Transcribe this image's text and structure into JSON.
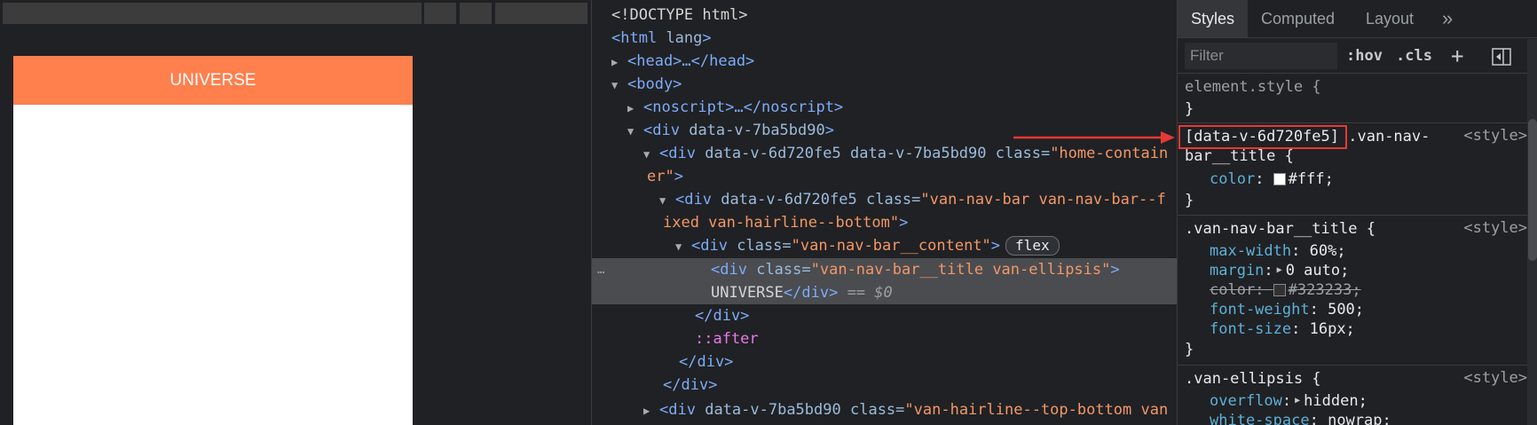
{
  "preview": {
    "app_title": "UNIVERSE",
    "navbar_color": "#ff7f4d"
  },
  "elements": {
    "lines": [
      {
        "doctype": "<!DOCTYPE html>"
      },
      {
        "html_open": "<html",
        "attr": "lang",
        "close": ">"
      },
      {
        "head": "<head>…</head>"
      },
      {
        "body": "<body>"
      },
      {
        "noscript": "<noscript>…</noscript>"
      },
      {
        "tag": "<div",
        "attr": "data-v-7ba5bd90",
        "close": ">"
      },
      {
        "tag": "<div",
        "attr1": "data-v-6d720fe5",
        "attr2": "data-v-7ba5bd90",
        "attr3": "class=",
        "val": "\"home-contain",
        "val_cont": "er\"",
        "close": ">"
      },
      {
        "tag": "<div",
        "attr1": "data-v-6d720fe5",
        "attr2": "class=",
        "val": "\"van-nav-bar van-nav-bar--f",
        "val_cont": "ixed van-hairline--bottom\"",
        "close": ">"
      },
      {
        "tag": "<div",
        "attr": "class=",
        "val": "\"van-nav-bar__content\"",
        "close": ">",
        "badge": "flex"
      },
      {
        "tag": "<div",
        "attr": "class=",
        "val": "\"van-nav-bar__title van-ellipsis\"",
        "close": ">",
        "text": "UNIVERSE",
        "end_tag": "</div>",
        "eq": "== ",
        "eq_var": "$0",
        "dots": "…"
      },
      {
        "close_div1": "</div>"
      },
      {
        "after": "::after"
      },
      {
        "close_div2": "</div>"
      },
      {
        "close_div3": "</div>"
      },
      {
        "tag": "<div",
        "attr1": "data-v-7ba5bd90",
        "attr2": "class=",
        "val": "\"van-hairline--top-bottom van"
      }
    ]
  },
  "styles": {
    "tabs": [
      "Styles",
      "Computed",
      "Layout"
    ],
    "more_tabs": "»",
    "filter_placeholder": "Filter",
    "hov": ":hov",
    "cls": ".cls",
    "plus": "+",
    "element_style": "element.style {",
    "close_brace": "}",
    "rule1": {
      "selector_attr": "[data-v-6d720fe5]",
      "selector_rest": ".van-nav-",
      "selector_cont": "bar__title {",
      "source": "<style>",
      "prop": "color",
      "val": "#fff;"
    },
    "rule2": {
      "selector": ".van-nav-bar__title {",
      "source": "<style>",
      "props": [
        {
          "name": "max-width",
          "value": "60%;"
        },
        {
          "name": "margin",
          "value": "0 auto;"
        },
        {
          "name": "color",
          "value": "#323233;"
        },
        {
          "name": "font-weight",
          "value": "500;"
        },
        {
          "name": "font-size",
          "value": "16px;"
        }
      ]
    },
    "rule3": {
      "selector": ".van-ellipsis {",
      "source": "<style>",
      "props": [
        {
          "name": "overflow",
          "value": "hidden;"
        },
        {
          "name": "white-space",
          "value": "nowrap;"
        }
      ]
    },
    "colors": {
      "white_swatch": "#ffffff",
      "dark_swatch": "#323233",
      "highlight": "#e53935"
    }
  }
}
